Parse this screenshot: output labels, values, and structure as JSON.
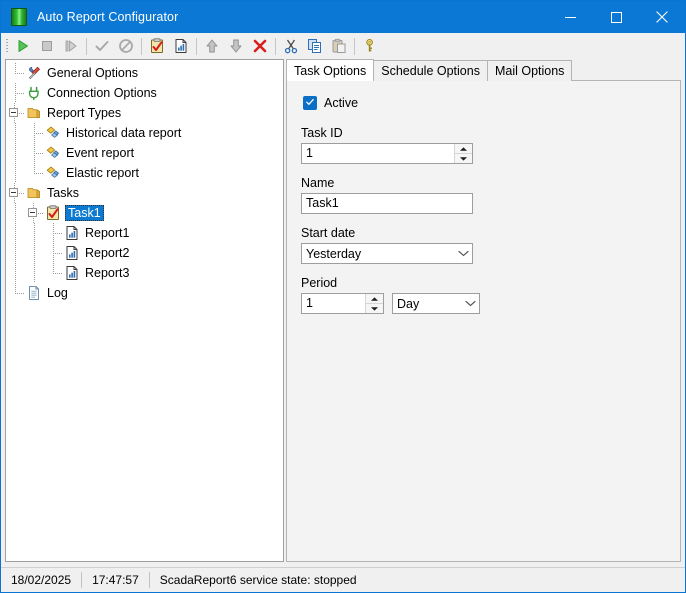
{
  "window": {
    "title": "Auto Report Configurator",
    "app_icon": "green-report-icon",
    "controls": {
      "minimize": "minimize-icon",
      "maximize": "maximize-icon",
      "close": "close-icon"
    },
    "accent_color": "#0a78d4"
  },
  "toolbar": {
    "buttons": [
      {
        "name": "start-button",
        "icon": "play-icon",
        "enabled": true
      },
      {
        "name": "stop-button",
        "icon": "stop-icon",
        "enabled": false
      },
      {
        "name": "step-button",
        "icon": "step-icon",
        "enabled": false
      },
      {
        "name": "apply-button",
        "icon": "check-icon",
        "enabled": false
      },
      {
        "name": "cancel-button",
        "icon": "forbidden-icon",
        "enabled": false
      },
      {
        "name": "add-task-button",
        "icon": "clipboard-check-icon",
        "enabled": true
      },
      {
        "name": "add-report-button",
        "icon": "report-document-icon",
        "enabled": true
      },
      {
        "name": "move-up-button",
        "icon": "arrow-up-icon",
        "enabled": true
      },
      {
        "name": "move-down-button",
        "icon": "arrow-down-icon",
        "enabled": true
      },
      {
        "name": "delete-button",
        "icon": "red-x-icon",
        "enabled": true
      },
      {
        "name": "cut-button",
        "icon": "scissors-icon",
        "enabled": true
      },
      {
        "name": "copy-button",
        "icon": "copy-icon",
        "enabled": true
      },
      {
        "name": "paste-button",
        "icon": "paste-icon",
        "enabled": false
      },
      {
        "name": "license-button",
        "icon": "key-icon",
        "enabled": true
      }
    ]
  },
  "tree": {
    "nodes": [
      {
        "label": "General Options",
        "icon": "tools-icon",
        "level": 0,
        "selected": false
      },
      {
        "label": "Connection Options",
        "icon": "plug-icon",
        "level": 0,
        "selected": false
      },
      {
        "label": "Report Types",
        "icon": "folder-icon",
        "level": 0,
        "selected": false,
        "expanded": true
      },
      {
        "label": "Historical data report",
        "icon": "report-type-icon",
        "level": 1,
        "selected": false
      },
      {
        "label": "Event report",
        "icon": "report-type-icon",
        "level": 1,
        "selected": false
      },
      {
        "label": "Elastic report",
        "icon": "report-type-icon",
        "level": 1,
        "selected": false
      },
      {
        "label": "Tasks",
        "icon": "folder-icon",
        "level": 0,
        "selected": false,
        "expanded": true
      },
      {
        "label": "Task1",
        "icon": "clipboard-check-icon",
        "level": 1,
        "selected": true,
        "expanded": true
      },
      {
        "label": "Report1",
        "icon": "report-document-icon",
        "level": 2,
        "selected": false
      },
      {
        "label": "Report2",
        "icon": "report-document-icon",
        "level": 2,
        "selected": false
      },
      {
        "label": "Report3",
        "icon": "report-document-icon",
        "level": 2,
        "selected": false
      },
      {
        "label": "Log",
        "icon": "log-page-icon",
        "level": 0,
        "selected": false
      }
    ]
  },
  "tabs": [
    {
      "label": "Task Options",
      "active": true
    },
    {
      "label": "Schedule Options",
      "active": false
    },
    {
      "label": "Mail Options",
      "active": false
    }
  ],
  "task_options": {
    "active": {
      "label": "Active",
      "checked": true
    },
    "task_id": {
      "label": "Task ID",
      "value": "1"
    },
    "name": {
      "label": "Name",
      "value": "Task1"
    },
    "start_date": {
      "label": "Start date",
      "value": "Yesterday"
    },
    "period": {
      "label": "Period",
      "value": "1",
      "unit": "Day"
    }
  },
  "statusbar": {
    "date": "18/02/2025",
    "time": "17:47:57",
    "message": "ScadaReport6 service state: stopped"
  }
}
